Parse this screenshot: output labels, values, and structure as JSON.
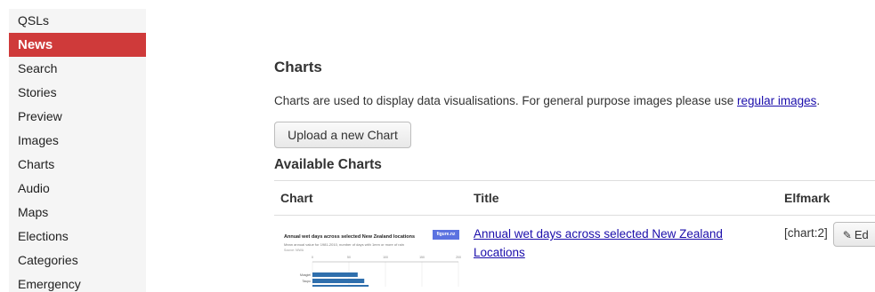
{
  "sidebar": {
    "items": [
      {
        "label": "QSLs",
        "active": false
      },
      {
        "label": "News",
        "active": true
      },
      {
        "label": "Search",
        "active": false
      },
      {
        "label": "Stories",
        "active": false
      },
      {
        "label": "Preview",
        "active": false
      },
      {
        "label": "Images",
        "active": false
      },
      {
        "label": "Charts",
        "active": false
      },
      {
        "label": "Audio",
        "active": false
      },
      {
        "label": "Maps",
        "active": false
      },
      {
        "label": "Elections",
        "active": false
      },
      {
        "label": "Categories",
        "active": false
      },
      {
        "label": "Emergency",
        "active": false
      }
    ]
  },
  "main": {
    "heading": "Charts",
    "intro_text": "Charts are used to display data visualisations. For general purpose images please use ",
    "intro_link": "regular images",
    "intro_end": ".",
    "upload_button": "Upload a new Chart",
    "section_heading": "Available Charts",
    "table": {
      "columns": [
        "Chart",
        "Title",
        "Elfmark"
      ],
      "rows": [
        {
          "title": "Annual wet days across selected New Zealand Locations",
          "elfmark": "[chart:2]",
          "edit_label": "Ed",
          "thumbnail": {
            "title": "Annual wet days across selected New Zealand locations",
            "subtitle": "Mean annual value for 1981-2010, number of days with 1mm or more of rain",
            "source": "Source: NIWA",
            "logo": "figure.nz",
            "axis_ticks": [
              "0",
              "50",
              "100",
              "150",
              "200"
            ],
            "bars": [
              {
                "label": "Mosgiel",
                "value": 62
              },
              {
                "label": "Taupo",
                "value": 71
              },
              {
                "label": "",
                "value": 77
              }
            ]
          }
        }
      ]
    }
  },
  "icons": {
    "edit": "edit-icon"
  }
}
